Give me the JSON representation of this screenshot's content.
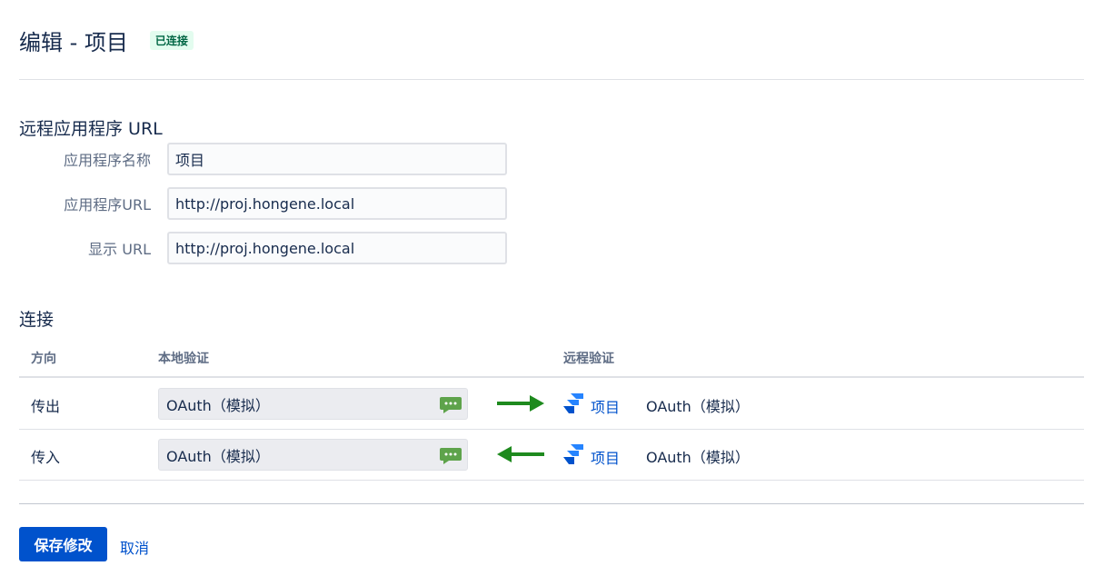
{
  "header": {
    "title": "编辑 - 项目",
    "status_badge": "已连接"
  },
  "remote_app": {
    "section_title": "远程应用程序 URL",
    "fields": [
      {
        "label": "应用程序名称",
        "value": "项目"
      },
      {
        "label": "应用程序URL",
        "value": "http://proj.hongene.local"
      },
      {
        "label": "显示 URL",
        "value": "http://proj.hongene.local"
      }
    ]
  },
  "connection": {
    "section_title": "连接",
    "columns": {
      "direction": "方向",
      "local_auth": "本地验证",
      "remote_auth": "远程验证"
    },
    "rows": [
      {
        "direction": "传出",
        "local_auth": "OAuth（模拟）",
        "arrow": "right",
        "remote_app": "项目",
        "remote_auth": "OAuth（模拟）"
      },
      {
        "direction": "传入",
        "local_auth": "OAuth（模拟）",
        "arrow": "left",
        "remote_app": "项目",
        "remote_auth": "OAuth（模拟）"
      }
    ]
  },
  "icons": {
    "local_auth_icon": "speech-bubble-icon",
    "outgoing_arrow": "arrow-right-icon",
    "incoming_arrow": "arrow-left-icon",
    "remote_app_icon": "jira-logo-icon"
  },
  "colors": {
    "primary": "#0052cc",
    "success_badge_bg": "#e3fcef",
    "success_badge_text": "#006644",
    "arrow_green": "#1e8a1e",
    "bubble_green": "#5ea34b"
  },
  "actions": {
    "save_label": "保存修改",
    "cancel_label": "取消"
  }
}
